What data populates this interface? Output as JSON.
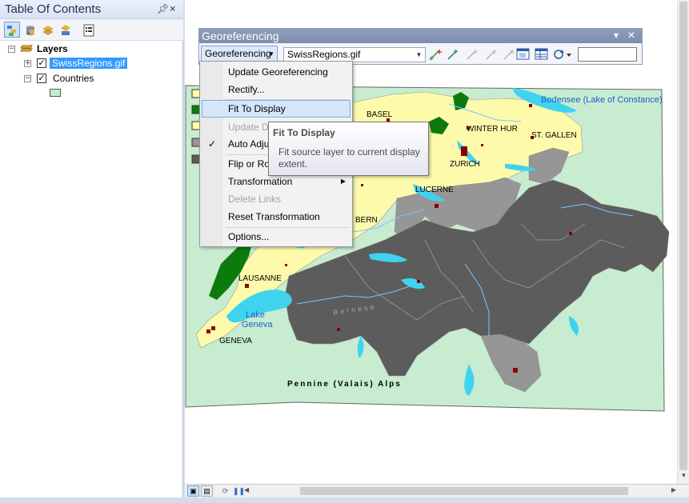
{
  "toc": {
    "title": "Table Of Contents",
    "pin_icon": "pin-icon",
    "close_glyph": "×",
    "toolbar": [
      "list-by-drawing-order-icon",
      "list-by-source-icon",
      "list-by-visibility-icon",
      "list-by-selection-icon",
      "options-icon"
    ],
    "tree": {
      "root": "Layers",
      "layers": [
        {
          "name": "SwissRegions.gif",
          "checked": true,
          "expanded": false,
          "selected": true
        },
        {
          "name": "Countries",
          "checked": true,
          "expanded": true,
          "selected": false
        }
      ],
      "countries_swatch_color": "#c8ecd0"
    }
  },
  "georef": {
    "title": "Georeferencing",
    "menu_label": "Georeferencing",
    "layer_value": "SwissRegions.gif",
    "input_value": "",
    "tools": [
      "add-control-points-icon",
      "auto-registration-icon",
      "select-link-icon",
      "zoom-to-link-icon",
      "delete-link-icon",
      "viewer-icon",
      "link-table-icon",
      "rotate-icon"
    ]
  },
  "menu": {
    "items": [
      {
        "label": "Update Georeferencing",
        "state": "normal"
      },
      {
        "label": "Rectify...",
        "state": "normal"
      },
      {
        "label": "Fit To Display",
        "state": "hover"
      },
      {
        "label": "Update Display",
        "state": "disabled"
      },
      {
        "label": "Auto Adjust",
        "state": "checked"
      },
      {
        "label": "Flip or Rotate",
        "state": "submenu"
      },
      {
        "label": "Transformation",
        "state": "submenu"
      },
      {
        "label": "Delete Links",
        "state": "disabled"
      },
      {
        "label": "Reset Transformation",
        "state": "normal"
      },
      {
        "label": "Options...",
        "state": "normal"
      }
    ]
  },
  "tooltip": {
    "title": "Fit To Display",
    "body": "Fit source layer to current display extent."
  },
  "map": {
    "labels": {
      "basel": "BASEL",
      "winterthur": "WINTER HUR",
      "st_gallen": "ST. GALLEN",
      "zurich": "ZURICH",
      "lucerne": "LUCERNE",
      "bern": "BERN",
      "lausanne": "LAUSANNE",
      "geneva": "GENEVA",
      "bodensee": "Bodensee (Lake of Constance)",
      "lake_geneva_1": "Lake",
      "lake_geneva_2": "Geneva",
      "alps": "Pennine (Valais) Alps",
      "bernese": "Bernese"
    },
    "colors": {
      "country": "#c8ecd0",
      "plateau": "#fdfbab",
      "alps_dark": "#5c5c5c",
      "alps_mid": "#969696",
      "forest": "#0d7a0d",
      "water": "#3fd3f0",
      "city": "#8b0000"
    }
  },
  "status": {
    "layout_view_icon": "layout-view-icon",
    "data_view_icon": "data-view-icon",
    "refresh_icon": "refresh-icon",
    "pause_icon": "pause-icon"
  }
}
